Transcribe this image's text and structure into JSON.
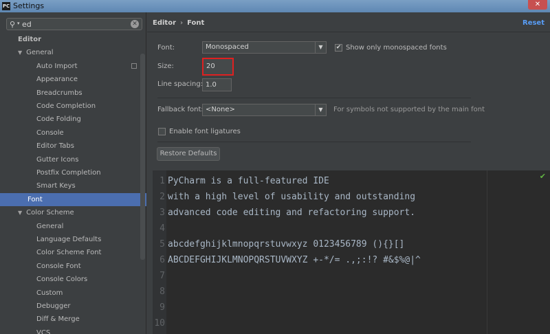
{
  "window": {
    "title": "Settings",
    "app_icon": "PC",
    "close": "✕"
  },
  "search": {
    "value": "ed"
  },
  "sidebar": {
    "items": [
      {
        "label": "Editor",
        "level": 0
      },
      {
        "label": "General",
        "level": 1
      },
      {
        "label": "Auto Import",
        "level": 2
      },
      {
        "label": "Appearance",
        "level": 2
      },
      {
        "label": "Breadcrumbs",
        "level": 2
      },
      {
        "label": "Code Completion",
        "level": 2
      },
      {
        "label": "Code Folding",
        "level": 2
      },
      {
        "label": "Console",
        "level": 2
      },
      {
        "label": "Editor Tabs",
        "level": 2
      },
      {
        "label": "Gutter Icons",
        "level": 2
      },
      {
        "label": "Postfix Completion",
        "level": 2
      },
      {
        "label": "Smart Keys",
        "level": 2
      },
      {
        "label": "Font",
        "level": 1
      },
      {
        "label": "Color Scheme",
        "level": 1
      },
      {
        "label": "General",
        "level": 2
      },
      {
        "label": "Language Defaults",
        "level": 2
      },
      {
        "label": "Color Scheme Font",
        "level": 2
      },
      {
        "label": "Console Font",
        "level": 2
      },
      {
        "label": "Console Colors",
        "level": 2
      },
      {
        "label": "Custom",
        "level": 2
      },
      {
        "label": "Debugger",
        "level": 2
      },
      {
        "label": "Diff & Merge",
        "level": 2
      },
      {
        "label": "VCS",
        "level": 2
      }
    ]
  },
  "breadcrumb": {
    "parent": "Editor",
    "current": "Font",
    "sep": "›"
  },
  "reset": "Reset",
  "font": {
    "label": "Font:",
    "value": "Monospaced",
    "only_mono_label": "Show only monospaced fonts",
    "only_mono_checked": "✔"
  },
  "size": {
    "label": "Size:",
    "value": "20"
  },
  "spacing": {
    "label": "Line spacing:",
    "value": "1.0"
  },
  "fallback": {
    "label": "Fallback font:",
    "value": "<None>",
    "hint": "For symbols not supported by the main font"
  },
  "ligatures": {
    "label": "Enable font ligatures"
  },
  "restore": "Restore Defaults",
  "preview": {
    "lines": [
      {
        "n": "1",
        "text": "PyCharm is a full-featured IDE"
      },
      {
        "n": "2",
        "text": "with a high level of usability and outstanding"
      },
      {
        "n": "3",
        "text": "advanced code editing and refactoring support."
      },
      {
        "n": "4",
        "text": ""
      },
      {
        "n": "5",
        "text": "abcdefghijklmnopqrstuvwxyz 0123456789 (){}[]"
      },
      {
        "n": "6",
        "text": "ABCDEFGHIJKLMNOPQRSTUVWXYZ +-*/= .,;:!? #&$%@|^"
      },
      {
        "n": "7",
        "text": ""
      },
      {
        "n": "8",
        "text": ""
      },
      {
        "n": "9",
        "text": ""
      },
      {
        "n": "10",
        "text": ""
      }
    ]
  },
  "colors": {
    "selection": "#4b6eaf",
    "link": "#589df6",
    "highlight": "#e02020"
  }
}
